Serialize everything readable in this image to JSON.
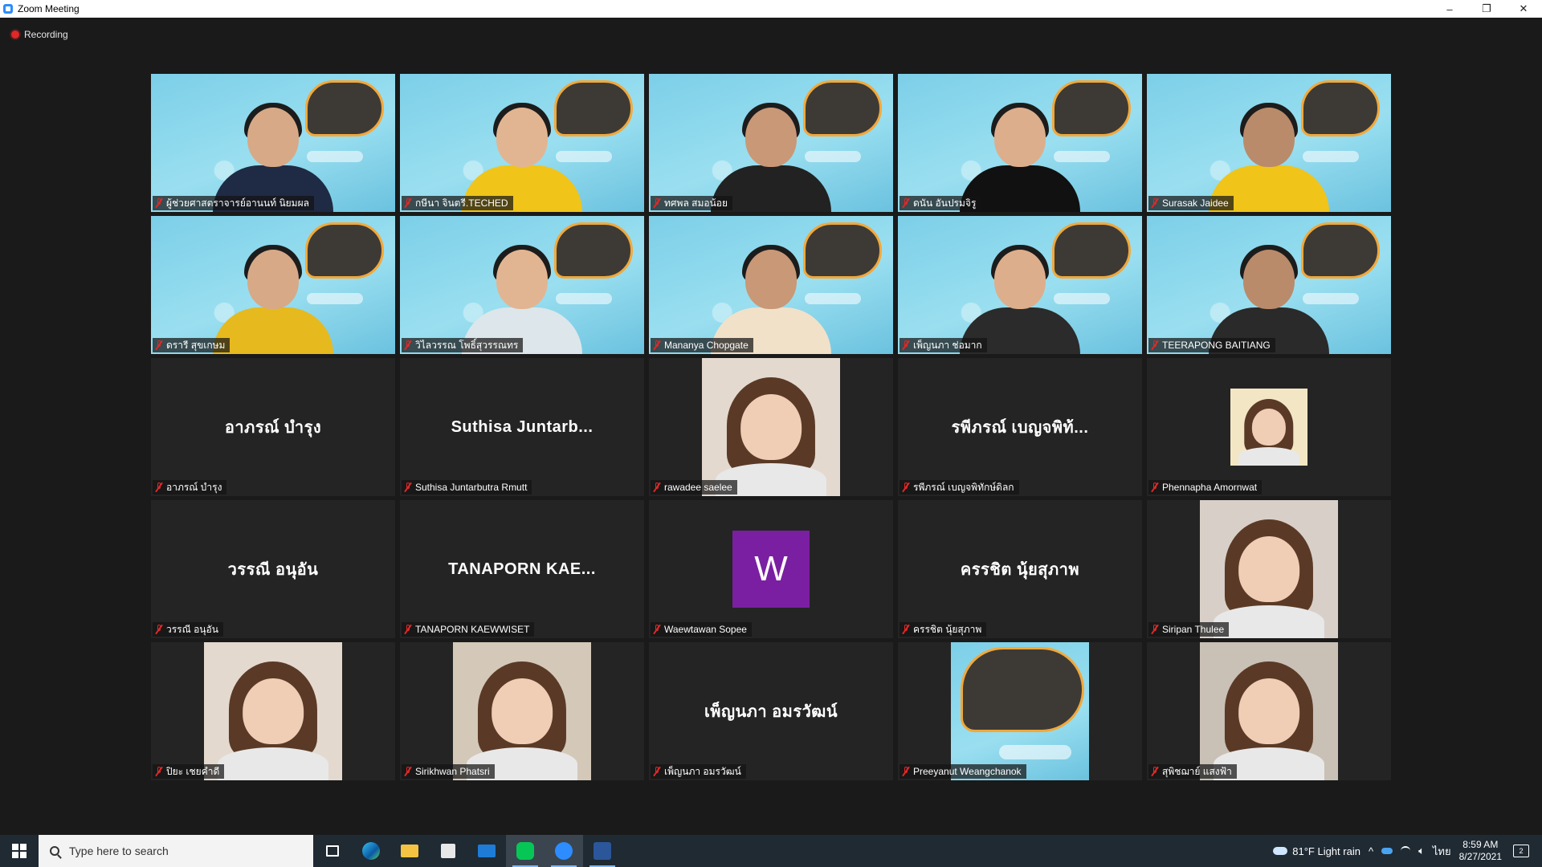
{
  "window": {
    "title": "Zoom Meeting",
    "controls": [
      "–",
      "❐",
      "✕"
    ]
  },
  "recording": {
    "label": "Recording"
  },
  "participants": [
    {
      "name": "ผู้ช่วยศาสตราจารย์อานนท์ นิยมผล",
      "view": "video"
    },
    {
      "name": "กษีนา  จินตรี.TECHED",
      "view": "video"
    },
    {
      "name": "ทศพล สมอน้อย",
      "view": "video"
    },
    {
      "name": "ดนัน อันปรมจิรู",
      "view": "video"
    },
    {
      "name": "Surasak Jaidee",
      "view": "video"
    },
    {
      "name": "ดรารี  สุขเกษม",
      "view": "video"
    },
    {
      "name": "วิไลวรรณ โพธิ์สุวรรณทร",
      "view": "video"
    },
    {
      "name": "Mananya Chopgate",
      "view": "video"
    },
    {
      "name": "เพ็ญนภา ช่อมาก",
      "view": "video"
    },
    {
      "name": "TEERAPONG  BAITIANG",
      "view": "video"
    },
    {
      "name": "อาภรณ์  บำรุง",
      "view": "name",
      "display_name": "อาภรณ์  บำรุง"
    },
    {
      "name": "Suthisa  Juntarbutra Rmutt",
      "view": "name",
      "display_name": "Suthisa  Juntarb..."
    },
    {
      "name": "rawadee saelee",
      "view": "photo"
    },
    {
      "name": "รพีภรณ์ เบญจพิทักษ์ดิลก",
      "view": "name",
      "display_name": "รพีภรณ์ เบญจพิท้..."
    },
    {
      "name": "Phennapha Amornwat",
      "view": "photo-small"
    },
    {
      "name": "วรรณี  อนุอัน",
      "view": "name",
      "display_name": "วรรณี  อนุอัน"
    },
    {
      "name": "TANAPORN KAEWWISET",
      "view": "name",
      "display_name": "TANAPORN  KAE..."
    },
    {
      "name": "Waewtawan Sopee",
      "view": "letter",
      "letter": "W"
    },
    {
      "name": "ครรชิต นุ้ยสุภาพ",
      "view": "name",
      "display_name": "ครรชิต นุ้ยสุภาพ"
    },
    {
      "name": "Siripan Thulee",
      "view": "photo"
    },
    {
      "name": "ปิยะ เชยคำดี",
      "view": "photo"
    },
    {
      "name": "Sirikhwan Phatsri",
      "view": "photo"
    },
    {
      "name": "เพ็ญนภา อมรวัฒน์",
      "view": "name",
      "display_name": "เพ็ญนภา อมรวัฒน์"
    },
    {
      "name": "Preeyanut Weangchanok",
      "view": "banner"
    },
    {
      "name": "สุพิชฌาย์ แสงฟ้า",
      "view": "photo"
    }
  ],
  "taskbar": {
    "search_placeholder": "Type here to search",
    "weather": "81°F  Light rain",
    "language": "ไทย",
    "time": "8:59 AM",
    "date": "8/27/2021",
    "notification_count": "2"
  },
  "colors": {
    "mute_red": "#e02828",
    "letter_avatar": "#7a1fa2",
    "taskbar": "#1f2a33"
  }
}
